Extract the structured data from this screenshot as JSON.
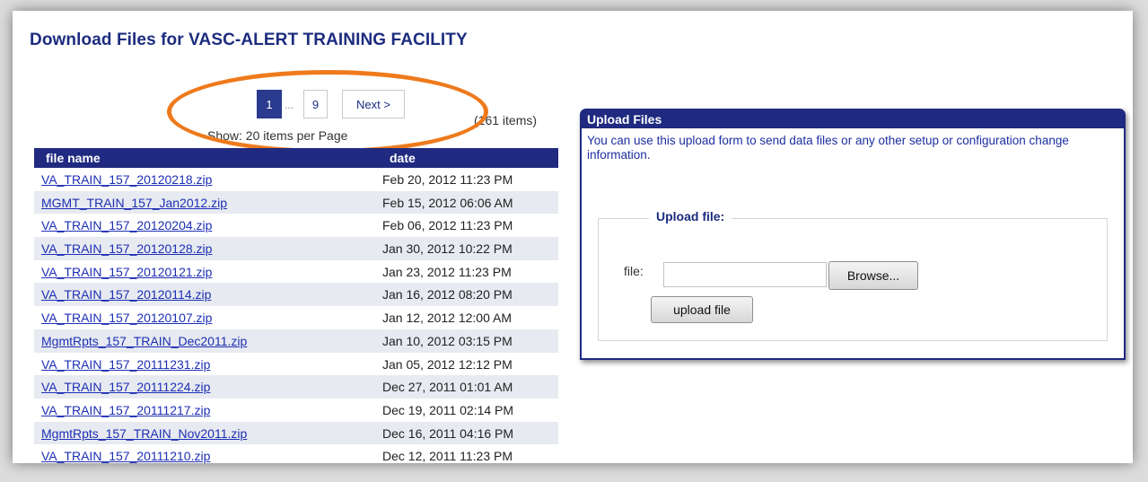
{
  "page": {
    "title": "Download Files for VASC-ALERT TRAINING FACILITY"
  },
  "pagination": {
    "current": "1",
    "ellipsis": "...",
    "last": "9",
    "next": "Next >",
    "items_count": "(161 items)",
    "per_page": "Show: 20 items per Page"
  },
  "table": {
    "headers": {
      "name": "file name",
      "date": "date"
    },
    "rows": [
      {
        "name": "VA_TRAIN_157_20120218.zip",
        "date": "Feb 20, 2012 11:23 PM"
      },
      {
        "name": "MGMT_TRAIN_157_Jan2012.zip",
        "date": "Feb 15, 2012 06:06 AM"
      },
      {
        "name": "VA_TRAIN_157_20120204.zip",
        "date": "Feb 06, 2012 11:23 PM"
      },
      {
        "name": "VA_TRAIN_157_20120128.zip",
        "date": "Jan 30, 2012 10:22 PM"
      },
      {
        "name": "VA_TRAIN_157_20120121.zip",
        "date": "Jan 23, 2012 11:23 PM"
      },
      {
        "name": "VA_TRAIN_157_20120114.zip",
        "date": "Jan 16, 2012 08:20 PM"
      },
      {
        "name": "VA_TRAIN_157_20120107.zip",
        "date": "Jan 12, 2012 12:00 AM"
      },
      {
        "name": "MgmtRpts_157_TRAIN_Dec2011.zip",
        "date": "Jan 10, 2012 03:15 PM"
      },
      {
        "name": "VA_TRAIN_157_20111231.zip",
        "date": "Jan 05, 2012 12:12 PM"
      },
      {
        "name": "VA_TRAIN_157_20111224.zip",
        "date": "Dec 27, 2011 01:01 AM"
      },
      {
        "name": "VA_TRAIN_157_20111217.zip",
        "date": "Dec 19, 2011 02:14 PM"
      },
      {
        "name": "MgmtRpts_157_TRAIN_Nov2011.zip",
        "date": "Dec 16, 2011 04:16 PM"
      },
      {
        "name": "VA_TRAIN_157_20111210.zip",
        "date": "Dec 12, 2011 11:23 PM"
      }
    ]
  },
  "upload": {
    "title": "Upload Files",
    "description": "You can use this upload form to send data files or any other setup or configuration change information.",
    "legend": "Upload file:",
    "file_label": "file:",
    "browse": "Browse...",
    "submit": "upload file"
  },
  "colors": {
    "header_bg": "#1f2a80",
    "link": "#1d2fb4",
    "highlight_oval": "#ee7a1c"
  }
}
